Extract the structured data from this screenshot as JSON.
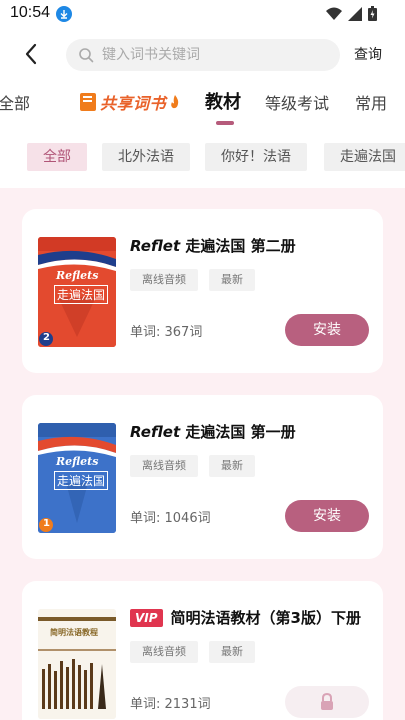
{
  "status": {
    "time": "10:54"
  },
  "search": {
    "placeholder": "键入词书关键词",
    "button_label": "查询"
  },
  "tabs": [
    {
      "label": "全部"
    },
    {
      "label": "共享词书"
    },
    {
      "label": "教材",
      "active": true
    },
    {
      "label": "等级考试"
    },
    {
      "label": "常用"
    }
  ],
  "filters": [
    {
      "label": "全部",
      "active": true
    },
    {
      "label": "北外法语"
    },
    {
      "label": "你好！法语"
    },
    {
      "label": "走遍法国"
    }
  ],
  "books": [
    {
      "title_italic": "Reflet",
      "title_rest": " 走遍法国 第二册",
      "tags": [
        "离线音频",
        "最新"
      ],
      "word_count": "单词: 367词",
      "action": "安装",
      "cover_text": "Reflets",
      "cover_subtitle": "走遍法国",
      "volume": "2"
    },
    {
      "title_italic": "Reflet",
      "title_rest": " 走遍法国 第一册",
      "tags": [
        "离线音频",
        "最新"
      ],
      "word_count": "单词: 1046词",
      "action": "安装",
      "cover_text": "Reflets",
      "cover_subtitle": "走遍法国",
      "volume": "1"
    },
    {
      "vip": "VIP",
      "title_rest": "简明法语教材（第3版）下册",
      "tags": [
        "离线音频",
        "最新"
      ],
      "word_count": "单词: 2131词",
      "locked": true,
      "cover_text": "简明法语教程"
    }
  ],
  "colors": {
    "accent": "#b8607f",
    "chip_active_bg": "#f6e1e8",
    "content_bg": "#fdf0f3",
    "vip": "#e0354f"
  }
}
